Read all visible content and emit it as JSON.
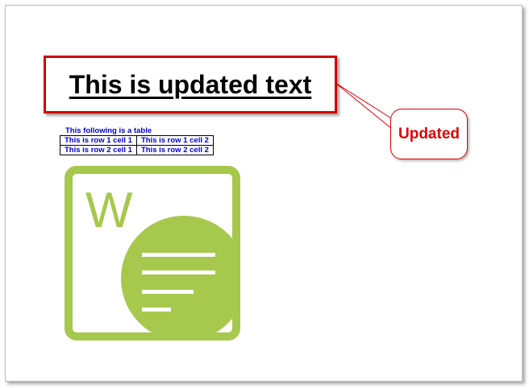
{
  "heading": {
    "text": "This is updated text"
  },
  "callout": {
    "text": "Updated"
  },
  "table": {
    "caption": "This following is a table",
    "rows": [
      [
        "This is row 1 cell 1",
        "This is row 1 cell 2"
      ],
      [
        "This is row 2 cell 1",
        "This is row 2 cell 2"
      ]
    ]
  },
  "logo": {
    "icon": "word-document-icon",
    "letter": "W",
    "color": "#a6c84c"
  },
  "colors": {
    "accent_red": "#d10000",
    "table_text": "#0000cc"
  }
}
